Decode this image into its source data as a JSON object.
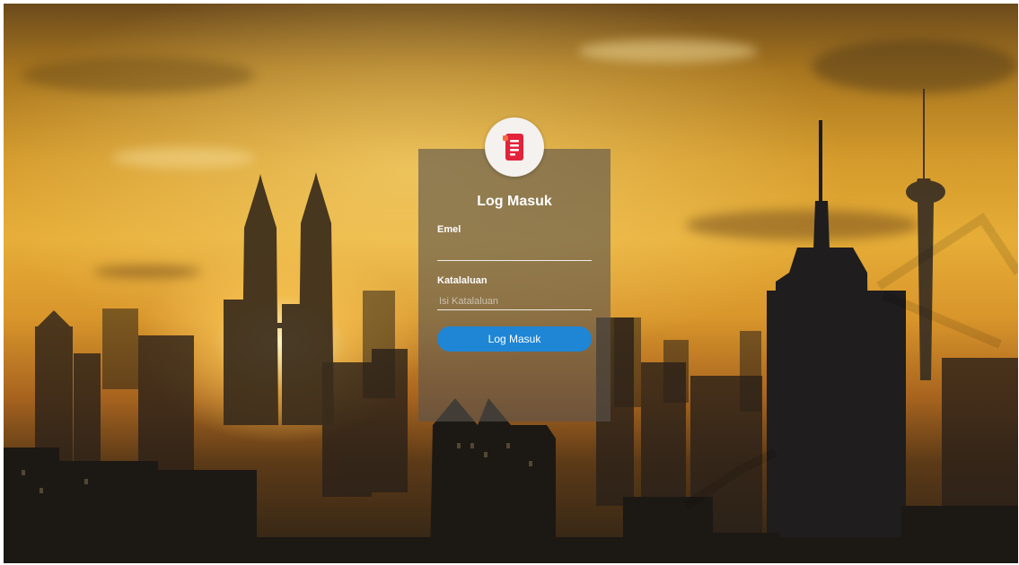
{
  "login": {
    "title": "Log Masuk",
    "email": {
      "label": "Emel",
      "value": "",
      "placeholder": ""
    },
    "password": {
      "label": "Katalaluan",
      "value": "",
      "placeholder": "Isi Katalaluan"
    },
    "submit_label": "Log Masuk"
  },
  "icons": {
    "logo": "document-icon"
  },
  "colors": {
    "button": "#1f86d6",
    "logo_red": "#e2233b",
    "panel": "#5a544e"
  }
}
